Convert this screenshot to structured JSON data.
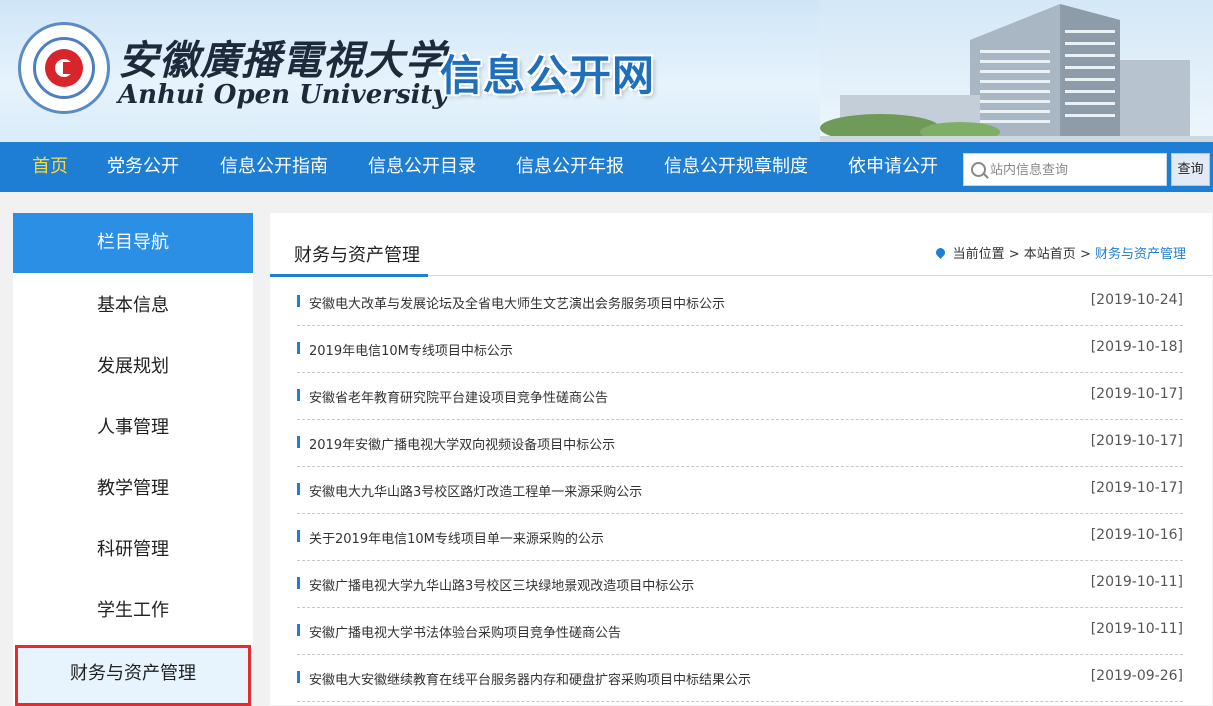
{
  "header": {
    "university_cn": "安徽廣播電視大学",
    "university_en": "Anhui Open University",
    "site_name": "信息公开网",
    "logo_icon": "university-seal"
  },
  "nav": {
    "items": [
      {
        "label": "首页",
        "active": true
      },
      {
        "label": "党务公开"
      },
      {
        "label": "信息公开指南"
      },
      {
        "label": "信息公开目录"
      },
      {
        "label": "信息公开年报"
      },
      {
        "label": "信息公开规章制度"
      },
      {
        "label": "依申请公开"
      }
    ],
    "search_placeholder": "站内信息查询",
    "search_button": "查询",
    "active_color": "#ffd83a",
    "bar_color": "#1e7ed3"
  },
  "sidebar": {
    "title": "栏目导航",
    "items": [
      {
        "label": "基本信息"
      },
      {
        "label": "发展规划"
      },
      {
        "label": "人事管理"
      },
      {
        "label": "教学管理"
      },
      {
        "label": "科研管理"
      },
      {
        "label": "学生工作"
      },
      {
        "label": "财务与资产管理",
        "current": true
      }
    ]
  },
  "main": {
    "title": "财务与资产管理",
    "breadcrumb": {
      "prefix": "当前位置",
      "home": "本站首页",
      "current": "财务与资产管理",
      "separator": ">"
    },
    "articles": [
      {
        "title": "安徽电大改革与发展论坛及全省电大师生文艺演出会务服务项目中标公示",
        "date": "[2019-10-24]"
      },
      {
        "title": "2019年电信10M专线项目中标公示",
        "date": "[2019-10-18]"
      },
      {
        "title": "安徽省老年教育研究院平台建设项目竞争性磋商公告",
        "date": "[2019-10-17]"
      },
      {
        "title": "2019年安徽广播电视大学双向视频设备项目中标公示",
        "date": "[2019-10-17]"
      },
      {
        "title": "安徽电大九华山路3号校区路灯改造工程单一来源采购公示",
        "date": "[2019-10-17]"
      },
      {
        "title": "关于2019年电信10M专线项目单一来源采购的公示",
        "date": "[2019-10-16]"
      },
      {
        "title": "安徽广播电视大学九华山路3号校区三块绿地景观改造项目中标公示",
        "date": "[2019-10-11]"
      },
      {
        "title": "安徽广播电视大学书法体验台采购项目竞争性磋商公告",
        "date": "[2019-10-11]"
      },
      {
        "title": "安徽电大安徽继续教育在线平台服务器内存和硬盘扩容采购项目中标结果公示",
        "date": "[2019-09-26]"
      }
    ]
  }
}
